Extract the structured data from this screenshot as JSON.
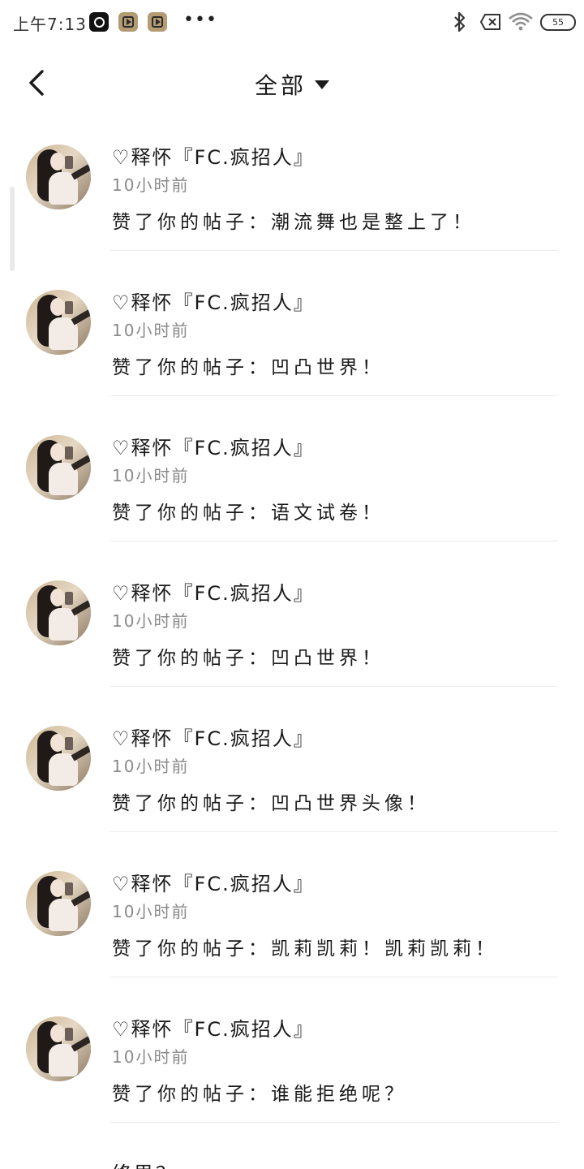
{
  "status_bar": {
    "time": "上午7:13",
    "more": "•••",
    "battery": "55",
    "icons": [
      "q-app-icon",
      "play-app-icon",
      "play-app-icon",
      "bluetooth-icon",
      "sim-off-icon",
      "wifi-icon",
      "battery-icon"
    ]
  },
  "header": {
    "title": "全部",
    "back_icon": "chevron-left-icon",
    "dropdown_icon": "caret-down-icon"
  },
  "notifications": [
    {
      "username": "♡释怀『FC.疯招人』",
      "time": "10小时前",
      "message": "赞了你的帖子：潮流舞也是整上了！"
    },
    {
      "username": "♡释怀『FC.疯招人』",
      "time": "10小时前",
      "message": "赞了你的帖子：凹凸世界！"
    },
    {
      "username": "♡释怀『FC.疯招人』",
      "time": "10小时前",
      "message": "赞了你的帖子：语文试卷！"
    },
    {
      "username": "♡释怀『FC.疯招人』",
      "time": "10小时前",
      "message": "赞了你的帖子：凹凸世界！"
    },
    {
      "username": "♡释怀『FC.疯招人』",
      "time": "10小时前",
      "message": "赞了你的帖子：凹凸世界头像！"
    },
    {
      "username": "♡释怀『FC.疯招人』",
      "time": "10小时前",
      "message": "赞了你的帖子：凯莉凯莉！凯莉凯莉！"
    },
    {
      "username": "♡释怀『FC.疯招人』",
      "time": "10小时前",
      "message": "赞了你的帖子：谁能拒绝呢？"
    }
  ],
  "partial_item_text": "终思？"
}
